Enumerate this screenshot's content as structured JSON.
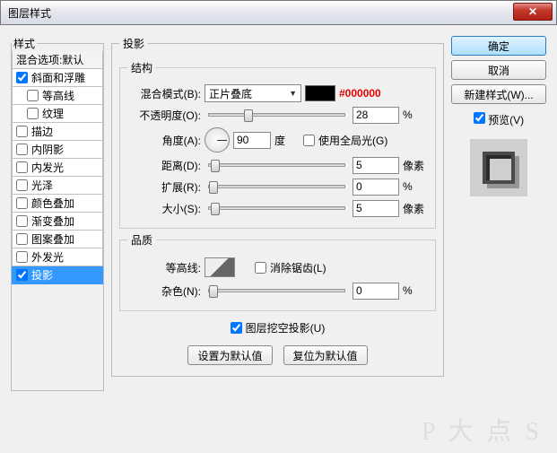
{
  "window": {
    "title": "图层样式"
  },
  "left": {
    "legend": "样式",
    "blend": "混合选项:默认",
    "items": [
      {
        "label": "斜面和浮雕",
        "checked": true
      },
      {
        "label": "等高线",
        "checked": false,
        "indent": true
      },
      {
        "label": "纹理",
        "checked": false,
        "indent": true
      },
      {
        "label": "描边",
        "checked": false
      },
      {
        "label": "内阴影",
        "checked": false
      },
      {
        "label": "内发光",
        "checked": false
      },
      {
        "label": "光泽",
        "checked": false
      },
      {
        "label": "颜色叠加",
        "checked": false
      },
      {
        "label": "渐变叠加",
        "checked": false
      },
      {
        "label": "图案叠加",
        "checked": false
      },
      {
        "label": "外发光",
        "checked": false
      },
      {
        "label": "投影",
        "checked": true,
        "selected": true
      }
    ]
  },
  "mid": {
    "legend": "投影",
    "structure": {
      "legend": "结构",
      "blend_label": "混合模式(B):",
      "blend_value": "正片叠底",
      "color_hex": "#000000",
      "opacity_label": "不透明度(O):",
      "opacity_value": "28",
      "percent": "%",
      "angle_label": "角度(A):",
      "angle_value": "90",
      "degree": "度",
      "global_label": "使用全局光(G)",
      "distance_label": "距离(D):",
      "distance_value": "5",
      "px": "像素",
      "spread_label": "扩展(R):",
      "spread_value": "0",
      "size_label": "大小(S):",
      "size_value": "5"
    },
    "quality": {
      "legend": "品质",
      "contour_label": "等高线:",
      "antialias_label": "消除锯齿(L)",
      "noise_label": "杂色(N):",
      "noise_value": "0"
    },
    "knockout_label": "图层挖空投影(U)",
    "defaults_btn": "设置为默认值",
    "reset_btn": "复位为默认值"
  },
  "right": {
    "ok": "确定",
    "cancel": "取消",
    "new_style": "新建样式(W)...",
    "preview_label": "预览(V)"
  },
  "watermark": "P 大 点 S"
}
